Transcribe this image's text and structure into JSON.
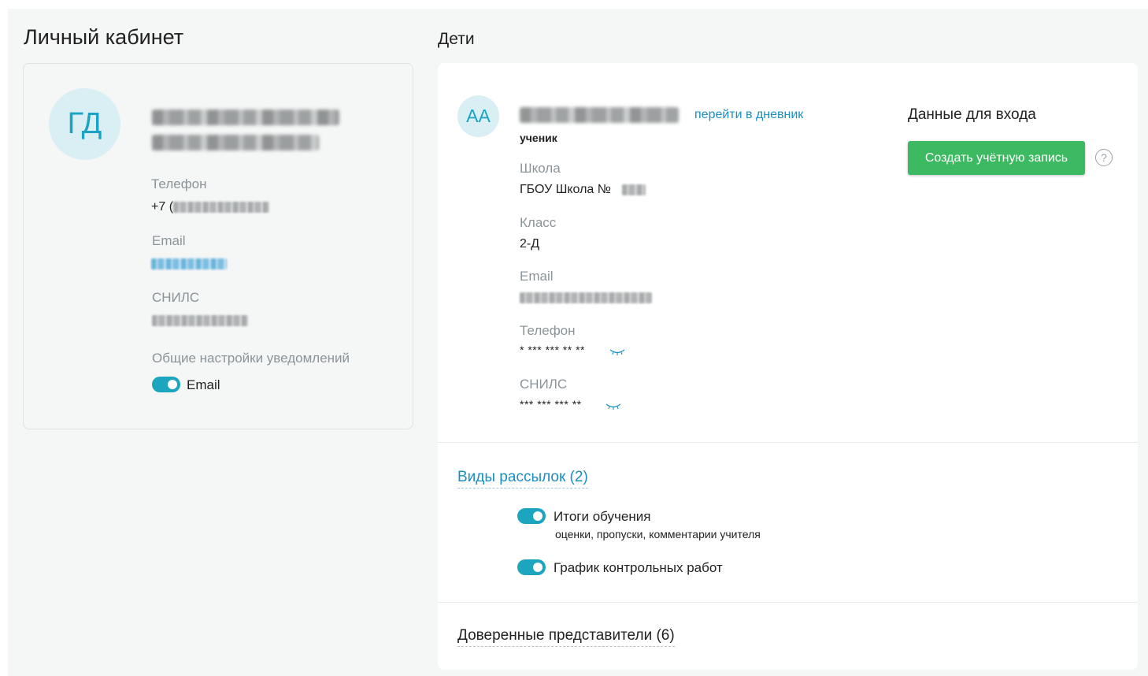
{
  "profile": {
    "page_title": "Личный кабинет",
    "initials": "ГД",
    "phone_label": "Телефон",
    "phone_prefix": "+7 (",
    "email_label": "Email",
    "snils_label": "СНИЛС",
    "notifications_label": "Общие настройки уведомлений",
    "notification_email_label": "Email",
    "notification_email_on": true
  },
  "children": {
    "section_title": "Дети",
    "child": {
      "initials": "АА",
      "diary_link": "перейти в дневник",
      "role": "ученик",
      "school_label": "Школа",
      "school_value": "ГБОУ Школа №",
      "class_label": "Класс",
      "class_value": "2-Д",
      "email_label": "Email",
      "phone_label": "Телефон",
      "phone_masked": "* *** *** ** **",
      "snils_label": "СНИЛС",
      "snils_masked": "*** *** *** **"
    },
    "login": {
      "title": "Данные для входа",
      "create_button": "Создать учётную запись",
      "help_glyph": "?"
    },
    "mailings": {
      "title": "Виды рассылок (2)",
      "items": [
        {
          "title": "Итоги обучения",
          "description": "оценки, пропуски, комментарии учителя",
          "enabled": true
        },
        {
          "title": "График контрольных работ",
          "description": "",
          "enabled": true
        }
      ]
    },
    "trusted": {
      "title": "Доверенные представители (6)"
    }
  },
  "colors": {
    "accent_teal": "#1ca5bf",
    "link_blue": "#1a8fc2",
    "button_green": "#3dba61",
    "avatar_bg": "#daeff4"
  }
}
